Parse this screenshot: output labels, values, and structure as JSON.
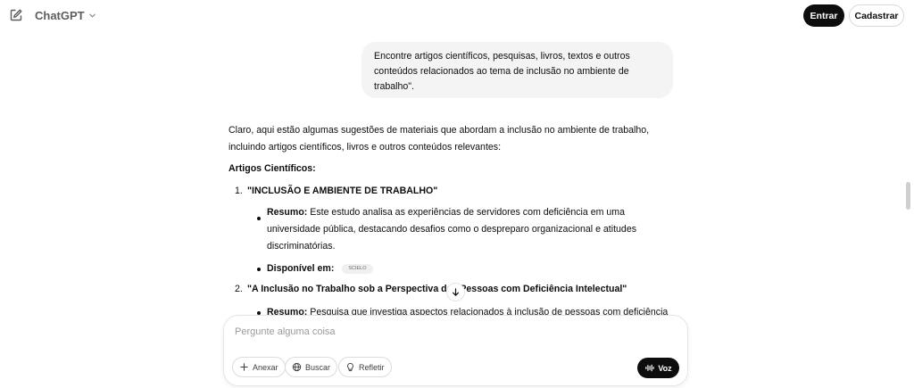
{
  "header": {
    "title": "ChatGPT",
    "login_label": "Entrar",
    "signup_label": "Cadastrar"
  },
  "user_message": "Encontre artigos científicos, pesquisas, livros, textos e outros conteúdos relacionados ao tema de inclusão no ambiente de trabalho\".",
  "assistant": {
    "intro": "Claro, aqui estão algumas sugestões de materiais que abordam a inclusão no ambiente de trabalho, incluindo artigos científicos, livros e outros conteúdos relevantes:",
    "section_title": "Artigos Científicos:",
    "items": [
      {
        "number": "1.",
        "title": "\"INCLUSÃO E AMBIENTE DE TRABALHO\"",
        "summary_label": "Resumo:",
        "summary": "Este estudo analisa as experiências de servidores com deficiência em uma universidade pública, destacando desafios como o despreparo organizacional e atitudes discriminatórias.",
        "available_label": "Disponível em:",
        "source_chip": "SCIELO"
      },
      {
        "number": "2.",
        "title": "\"A Inclusão no Trabalho sob a Perspectiva das Pessoas com Deficiência Intelectual\"",
        "summary_label": "Resumo:",
        "summary": "Pesquisa que investiga aspectos relacionados à inclusão de pessoas com deficiência"
      }
    ]
  },
  "composer": {
    "placeholder": "Pergunte alguma coisa",
    "attach_label": "Anexar",
    "search_label": "Buscar",
    "reason_label": "Refletir",
    "voice_label": "Voz"
  }
}
